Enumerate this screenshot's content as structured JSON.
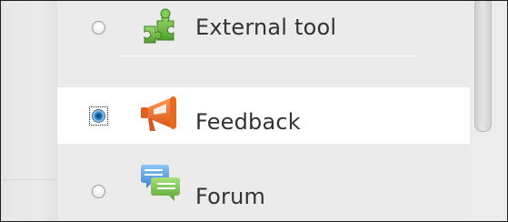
{
  "activity_chooser": {
    "items": [
      {
        "label": "External tool",
        "icon": "puzzle-piece-icon",
        "selected": false,
        "icon_color": "#6cc04a"
      },
      {
        "label": "Feedback",
        "icon": "megaphone-icon",
        "selected": true,
        "icon_color": "#f07a2a"
      },
      {
        "label": "Forum",
        "icon": "speech-bubbles-icon",
        "selected": false,
        "icon_color": "#5aa0e0"
      }
    ]
  },
  "colors": {
    "list_background": "#ebebeb",
    "selected_row_background": "#ffffff",
    "text": "#333333"
  }
}
